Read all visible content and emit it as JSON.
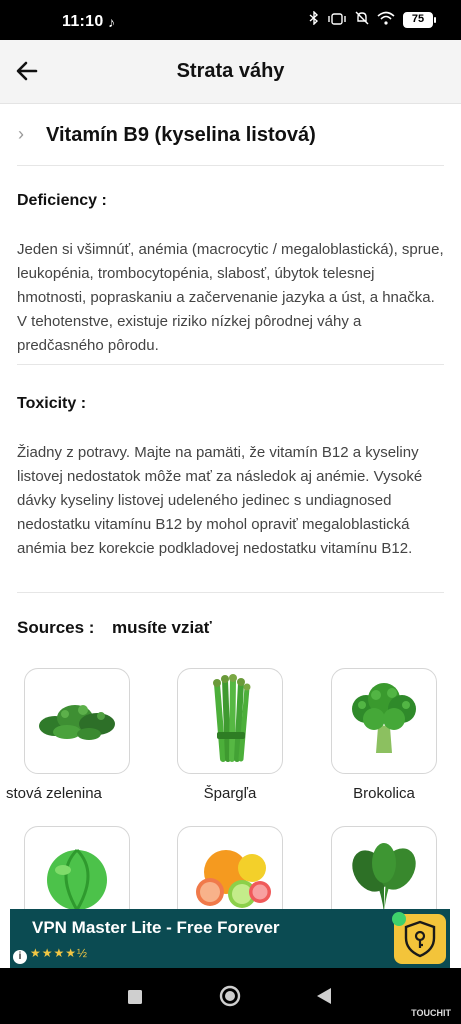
{
  "status_bar": {
    "time": "11:10",
    "notification_icon": "tiktok-icon",
    "battery": "75",
    "icons": [
      "bluetooth-icon",
      "vibrate-icon",
      "mute-icon",
      "wifi-icon",
      "battery-icon"
    ]
  },
  "app_bar": {
    "title": "Strata váhy",
    "back_icon": "arrow-left-icon"
  },
  "vitamin": {
    "title": "Vitamín B9 (kyselina listová)"
  },
  "deficiency": {
    "heading": "Deficiency :",
    "text": "Jeden si všimnúť, anémia (macrocytic / megaloblastická), sprue, leukopénia, trombocytopénia, slabosť, úbytok telesnej hmotnosti, popraskaniu a začervenanie jazyka a úst, a hnačka. V tehotenstve, existuje riziko nízkej pôrodnej váhy a predčasného pôrodu."
  },
  "toxicity": {
    "heading": "Toxicity :",
    "text": "Žiadny z potravy. Majte na pamäti, že vitamín B12 a kyseliny listovej nedostatok môže mať za následok aj anémie. Vysoké dávky kyseliny listovej udeleného jedinec s undiagnosed nedostatku vitamínu B12 by mohol opraviť megaloblastická anémia bez korekcie podkladovej nedostatku vitamínu B12."
  },
  "sources": {
    "label": "Sources :",
    "value": "musíte vziať",
    "items": [
      {
        "label": "stová zelenina",
        "icon": "leafy-greens-icon"
      },
      {
        "label": "Špargľa",
        "icon": "asparagus-icon"
      },
      {
        "label": "Brokolica",
        "icon": "broccoli-icon"
      },
      {
        "label": "",
        "icon": "cabbage-icon"
      },
      {
        "label": "",
        "icon": "citrus-fruits-icon"
      },
      {
        "label": "",
        "icon": "spinach-icon"
      }
    ]
  },
  "ad": {
    "title": "VPN Master Lite - Free Forever",
    "rating": "★★★★½",
    "info": "i",
    "icon": "vpn-shield-icon"
  },
  "nav_bar": {
    "watermark": "TOUCHIT",
    "buttons": [
      "recents-square-icon",
      "home-circle-icon",
      "back-triangle-icon"
    ]
  },
  "colors": {
    "ad_background": "#0b4b52",
    "ad_icon": "#f3c43a",
    "green": "#3a9a2e"
  }
}
